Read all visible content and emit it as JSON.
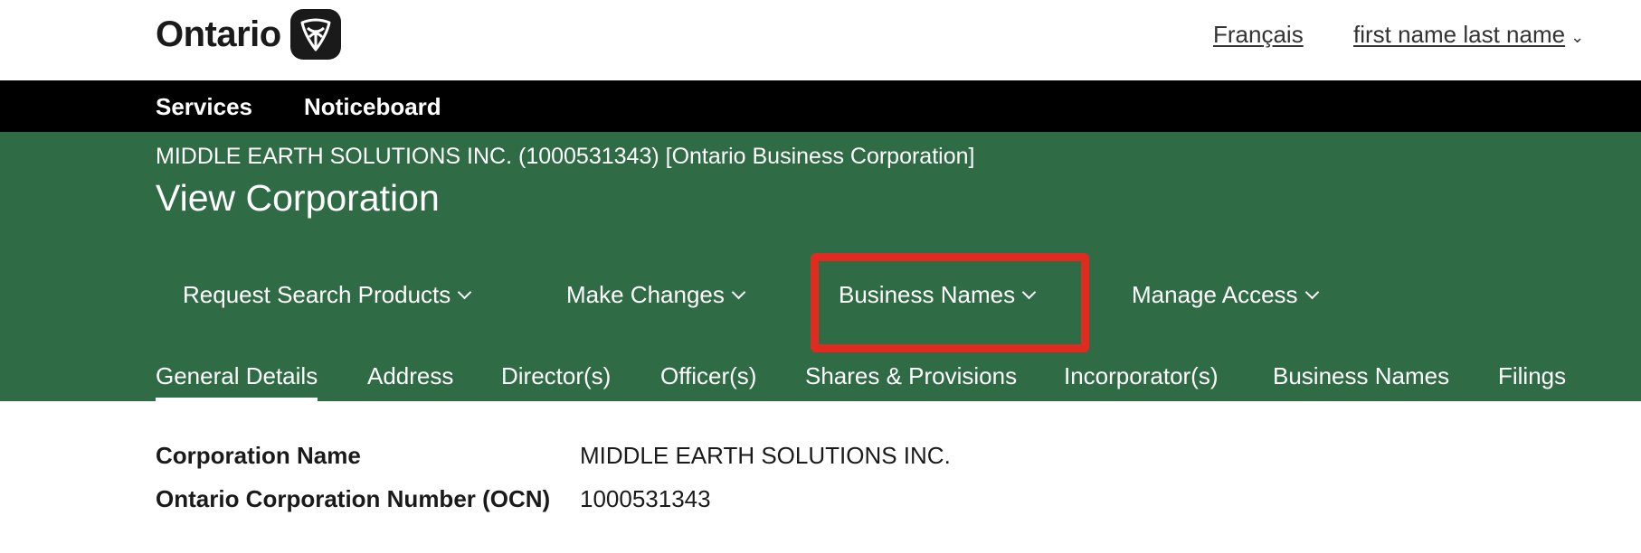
{
  "header": {
    "logo_text": "Ontario",
    "lang_link": "Français",
    "user_menu": "first name last name"
  },
  "nav": {
    "items": [
      "Services",
      "Noticeboard"
    ]
  },
  "corporation": {
    "heading": "MIDDLE EARTH SOLUTIONS INC. (1000531343) [Ontario Business Corporation]",
    "page_title": "View Corporation"
  },
  "actions": [
    {
      "label": "Request Search Products"
    },
    {
      "label": "Make Changes"
    },
    {
      "label": "Business Names"
    },
    {
      "label": "Manage Access"
    }
  ],
  "tabs": [
    {
      "label": "General Details",
      "active": true
    },
    {
      "label": "Address"
    },
    {
      "label": "Director(s)"
    },
    {
      "label": "Officer(s)"
    },
    {
      "label": "Shares & Provisions"
    },
    {
      "label": "Incorporator(s)"
    },
    {
      "label": "Business Names"
    },
    {
      "label": "Filings"
    }
  ],
  "details": [
    {
      "label": "Corporation Name",
      "value": "MIDDLE EARTH SOLUTIONS INC."
    },
    {
      "label": "Ontario Corporation Number (OCN)",
      "value": "1000531343"
    }
  ],
  "colors": {
    "brand_green": "#2f6b45",
    "nav_black": "#000000",
    "highlight_red": "#e02b20"
  },
  "icons": {
    "logo": "trillium-logo-icon",
    "user_menu_chevron": "chevron-down-icon",
    "action_chevron": "chevron-down-icon"
  }
}
